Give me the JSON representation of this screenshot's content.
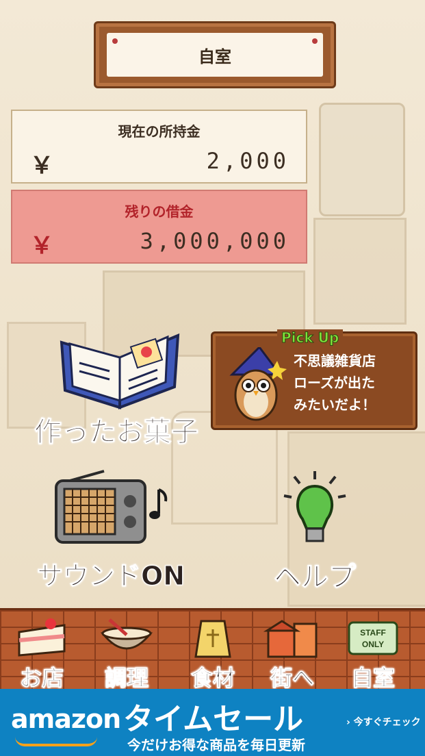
{
  "header": {
    "title": "自室"
  },
  "cash": {
    "label": "現在の所持金",
    "currency": "￥",
    "amount": "2,000"
  },
  "debt": {
    "label": "残りの借金",
    "currency": "￥",
    "amount": "3,000,000"
  },
  "menu": {
    "recipes_label": "作ったお菓子",
    "sound_label": "サウンドON",
    "help_label": "ヘルプ"
  },
  "pickup": {
    "tag": "Pick Up",
    "lines": [
      "不思議雑貨店",
      "ローズが出た",
      "みたいだよ！"
    ]
  },
  "tabs": [
    {
      "label": "お店",
      "icon": "cake-icon"
    },
    {
      "label": "調理",
      "icon": "mixing-bowl-icon"
    },
    {
      "label": "食材",
      "icon": "flour-sack-icon"
    },
    {
      "label": "街へ",
      "icon": "town-icon"
    },
    {
      "label": "自室",
      "icon": "staff-only-sign-icon"
    }
  ],
  "staff_sign": "STAFF ONLY",
  "ad": {
    "brand": "amazon",
    "headline": "タイムセール",
    "sub": "今だけお得な商品を毎日更新",
    "cta": "› 今すぐチェック"
  },
  "colors": {
    "debt_bg": "#ee9a92",
    "debt_text": "#b2232a",
    "ad_bg": "#0e82c2",
    "pickup_tag": "#7fe03a"
  }
}
